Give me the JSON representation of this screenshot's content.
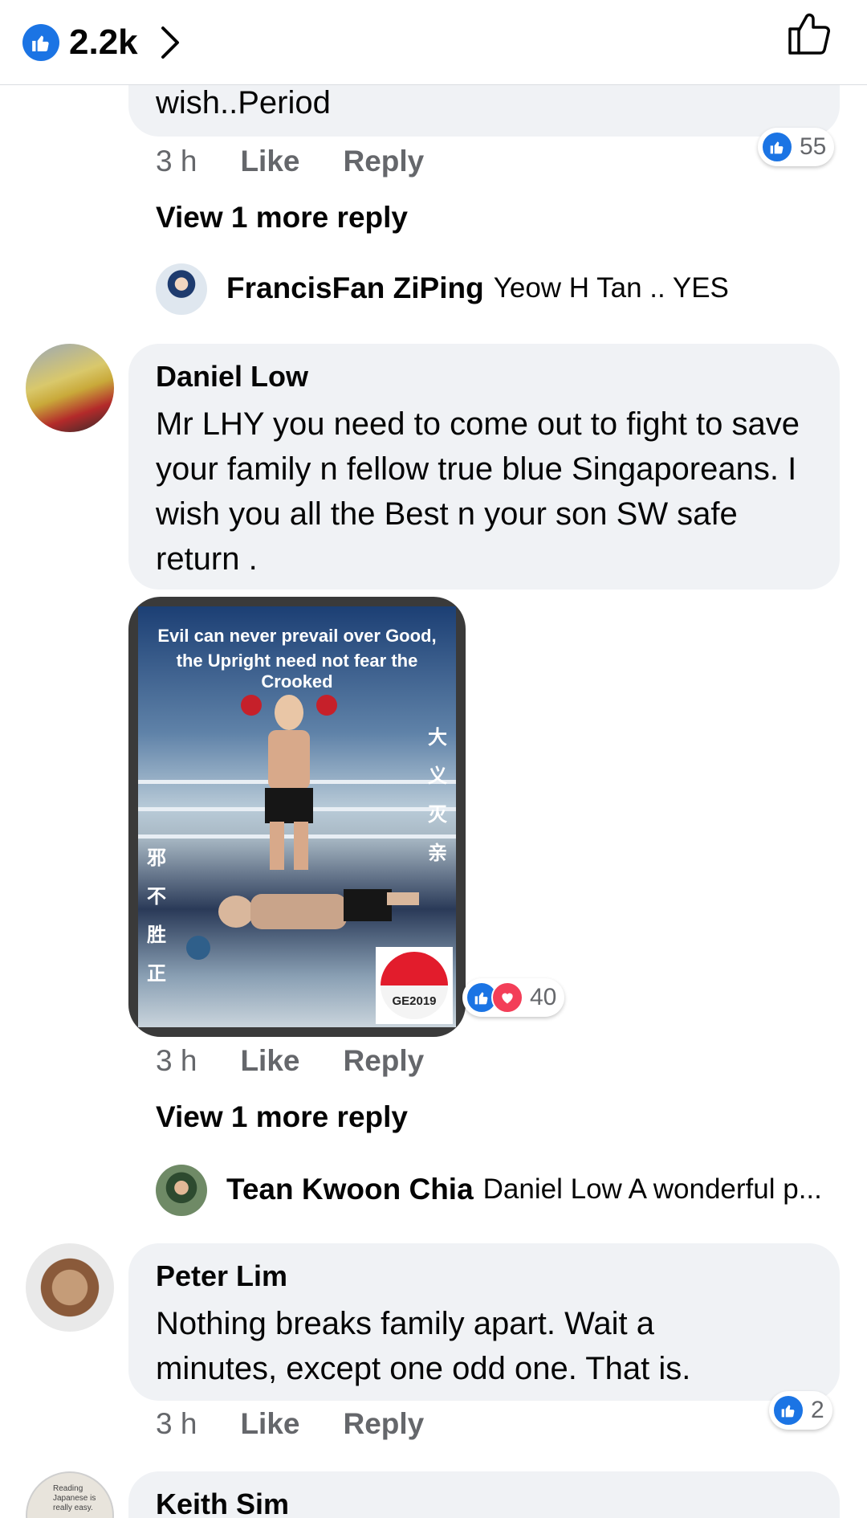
{
  "header": {
    "reaction_count": "2.2k"
  },
  "comments": [
    {
      "text_tail": "wish..Period",
      "time": "3 h",
      "like": "Like",
      "reply": "Reply",
      "reaction_count": "55",
      "view_more": "View 1 more reply",
      "reply_preview": {
        "name": "FrancisFan ZiPing",
        "text": "Yeow H Tan  .. YES"
      }
    },
    {
      "name": "Daniel Low",
      "text": "Mr LHY you need to come out to fight to save your family n fellow true blue Singaporeans. I wish you all the Best n your son SW safe return .",
      "image": {
        "caption_line1": "Evil can never prevail over Good,",
        "caption_line2": "the Upright need not fear the Crooked",
        "right_chars": [
          "大",
          "义",
          "灭",
          "亲"
        ],
        "left_chars": [
          "邪",
          "不",
          "胜",
          "正"
        ],
        "badge": "GE2019"
      },
      "time": "3 h",
      "like": "Like",
      "reply": "Reply",
      "reaction_count": "40",
      "view_more": "View 1 more reply",
      "reply_preview": {
        "name": "Tean Kwoon Chia",
        "text": "Daniel Low A wonderful p..."
      }
    },
    {
      "name": "Peter Lim",
      "text": "Nothing breaks family apart. Wait a minutes, except one odd one. That is.",
      "time": "3 h",
      "like": "Like",
      "reply": "Reply",
      "reaction_count": "2"
    },
    {
      "name": "Keith Sim",
      "avatar_text": "Reading Japanese is really easy."
    }
  ],
  "colors": {
    "like_blue": "#1b74e4",
    "love_red": "#f33e58",
    "bubble": "#f0f2f5",
    "secondary_text": "#65676b"
  }
}
